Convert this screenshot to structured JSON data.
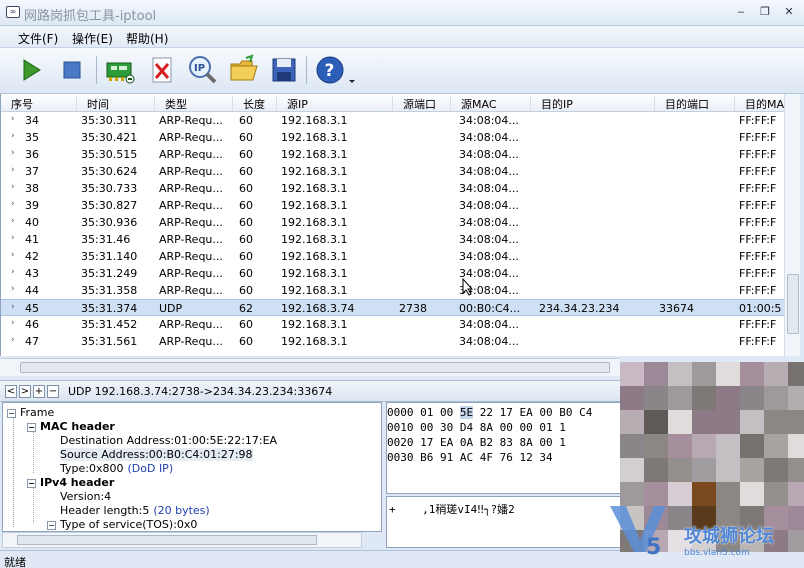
{
  "window": {
    "title": "网路岗抓包工具-iptool",
    "icon_label": "∞",
    "minimize": "‒",
    "restore": "❐",
    "close": "✕"
  },
  "menu": [
    "文件(F)",
    "操作(E)",
    "帮助(H)"
  ],
  "toolbar": {
    "buttons": [
      "start-capture",
      "stop-capture",
      "network-adapter",
      "clear-packets",
      "ip-filter",
      "open-file",
      "save-file",
      "help"
    ]
  },
  "table": {
    "columns": [
      "序号",
      "时间",
      "类型",
      "长度",
      "源IP",
      "源端口",
      "源MAC",
      "目的IP",
      "目的端口",
      "目的MAC"
    ],
    "rows": [
      [
        "34",
        "35:30.311",
        "ARP-Requ...",
        "60",
        "192.168.3.1",
        "",
        "34:08:04...",
        "",
        "",
        "FF:FF:F"
      ],
      [
        "35",
        "35:30.421",
        "ARP-Requ...",
        "60",
        "192.168.3.1",
        "",
        "34:08:04...",
        "",
        "",
        "FF:FF:F"
      ],
      [
        "36",
        "35:30.515",
        "ARP-Requ...",
        "60",
        "192.168.3.1",
        "",
        "34:08:04...",
        "",
        "",
        "FF:FF:F"
      ],
      [
        "37",
        "35:30.624",
        "ARP-Requ...",
        "60",
        "192.168.3.1",
        "",
        "34:08:04...",
        "",
        "",
        "FF:FF:F"
      ],
      [
        "38",
        "35:30.733",
        "ARP-Requ...",
        "60",
        "192.168.3.1",
        "",
        "34:08:04...",
        "",
        "",
        "FF:FF:F"
      ],
      [
        "39",
        "35:30.827",
        "ARP-Requ...",
        "60",
        "192.168.3.1",
        "",
        "34:08:04...",
        "",
        "",
        "FF:FF:F"
      ],
      [
        "40",
        "35:30.936",
        "ARP-Requ...",
        "60",
        "192.168.3.1",
        "",
        "34:08:04...",
        "",
        "",
        "FF:FF:F"
      ],
      [
        "41",
        "35:31.46",
        "ARP-Requ...",
        "60",
        "192.168.3.1",
        "",
        "34:08:04...",
        "",
        "",
        "FF:FF:F"
      ],
      [
        "42",
        "35:31.140",
        "ARP-Requ...",
        "60",
        "192.168.3.1",
        "",
        "34:08:04...",
        "",
        "",
        "FF:FF:F"
      ],
      [
        "43",
        "35:31.249",
        "ARP-Requ...",
        "60",
        "192.168.3.1",
        "",
        "34:08:04...",
        "",
        "",
        "FF:FF:F"
      ],
      [
        "44",
        "35:31.358",
        "ARP-Requ...",
        "60",
        "192.168.3.1",
        "",
        "34:08:04...",
        "",
        "",
        "FF:FF:F"
      ],
      [
        "45",
        "35:31.374",
        "UDP",
        "62",
        "192.168.3.74",
        "2738",
        "00:B0:C4...",
        "234.34.23.234",
        "33674",
        "01:00:5"
      ],
      [
        "46",
        "35:31.452",
        "ARP-Requ...",
        "60",
        "192.168.3.1",
        "",
        "34:08:04...",
        "",
        "",
        "FF:FF:F"
      ],
      [
        "47",
        "35:31.561",
        "ARP-Requ...",
        "60",
        "192.168.3.1",
        "",
        "34:08:04...",
        "",
        "",
        "FF:FF:F"
      ]
    ],
    "selected_index": 11
  },
  "detail": {
    "nav": [
      "<",
      ">",
      "+",
      "−"
    ],
    "summary": "UDP 192.168.3.74:2738->234.34.23.234:33674"
  },
  "tree": [
    {
      "indent": 0,
      "expander": "−",
      "text": "Frame",
      "bold": false
    },
    {
      "indent": 1,
      "expander": "−",
      "text": "MAC header",
      "bold": true
    },
    {
      "indent": 2,
      "expander": "",
      "text": "Destination Address:01:00:5E:22:17:EA",
      "bold": false
    },
    {
      "indent": 2,
      "expander": "",
      "text": "Source Address:00:B0:C4:01:27:98",
      "bold": false,
      "selected": true
    },
    {
      "indent": 2,
      "expander": "",
      "text": "Type:0x800",
      "extra": "(DoD IP)",
      "bold": false
    },
    {
      "indent": 1,
      "expander": "−",
      "text": "IPv4 header",
      "bold": true
    },
    {
      "indent": 2,
      "expander": "",
      "text": "Version:4",
      "bold": false
    },
    {
      "indent": 2,
      "expander": "",
      "text": "Header length:5",
      "extra": "(20 bytes)",
      "bold": false
    },
    {
      "indent": 2,
      "expander": "−",
      "text": "Type of service(TOS):0x0",
      "bold": false
    }
  ],
  "hex": [
    {
      "offset": "0000",
      "bytes": [
        "01",
        "00",
        "5E",
        "22",
        "17",
        "EA",
        "00",
        "B0",
        "C4"
      ],
      "highlight": [
        2
      ]
    },
    {
      "offset": "0010",
      "bytes": [
        "00",
        "30",
        "D4",
        "8A",
        "00",
        "00",
        "01",
        "1"
      ]
    },
    {
      "offset": "0020",
      "bytes": [
        "17",
        "EA",
        "0A",
        "B2",
        "83",
        "8A",
        "00",
        "1"
      ]
    },
    {
      "offset": "0030",
      "bytes": [
        "B6",
        "91",
        "AC",
        "4F",
        "76",
        "12",
        "34"
      ]
    }
  ],
  "ascii_text": "+    ,1稍瑳vI4‼┐?嬏2",
  "status": "就绪",
  "watermark": {
    "text": "攻城狮论坛",
    "sub": "bbs.vlan5.com"
  },
  "colors": {
    "selected_row": "#cfdff4",
    "highlight_text": "#1f3fae",
    "window_bg": "#dfe9f5"
  }
}
